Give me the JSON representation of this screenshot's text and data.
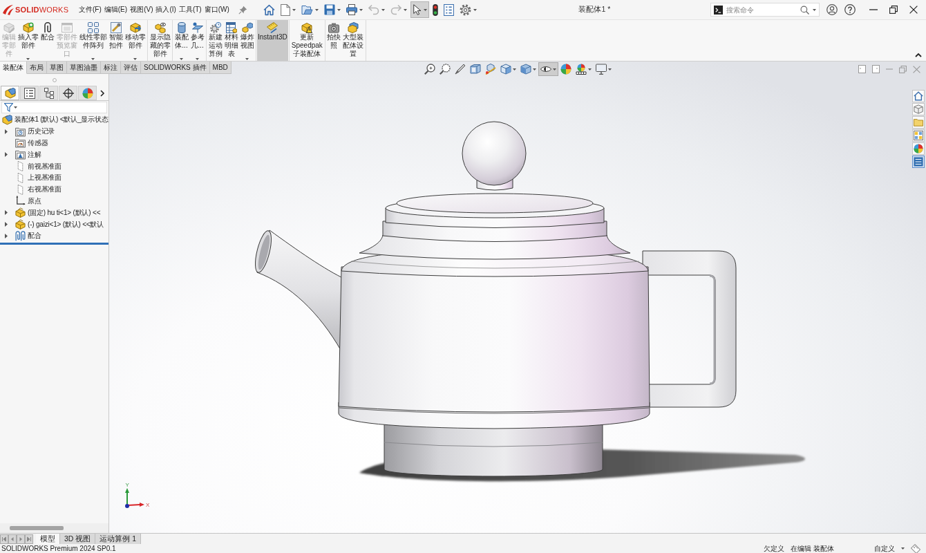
{
  "title_bar": {
    "logo": "**SOLID**WORKS",
    "menus": [
      "文件(F)",
      "编辑(E)",
      "视图(V)",
      "插入(I)",
      "工具(T)",
      "窗口(W)"
    ],
    "quick_access": [
      {
        "dropdown": false,
        "disabled": false,
        "selected": false
      },
      {
        "dropdown": true,
        "disabled": false,
        "selected": false
      },
      {
        "dropdown": true,
        "disabled": false,
        "selected": false
      },
      {
        "dropdown": true,
        "disabled": false,
        "selected": false
      },
      {
        "dropdown": true,
        "disabled": false,
        "selected": false
      },
      {
        "dropdown": true,
        "disabled": true,
        "selected": false
      },
      {
        "dropdown": true,
        "disabled": true,
        "selected": false
      },
      {
        "dropdown": true,
        "disabled": false,
        "selected": true
      },
      {
        "dropdown": false,
        "disabled": false,
        "selected": false
      },
      {
        "dropdown": false,
        "disabled": false,
        "selected": false
      },
      {
        "dropdown": true,
        "disabled": false,
        "selected": false
      }
    ],
    "title": "装配体1 *",
    "search": {
      "placeholder": "搜索命令"
    }
  },
  "ribbon": {
    "groups": [
      {
        "buttons": [
          {
            "label": "编辑零部件",
            "disabled": true,
            "selected": false,
            "dropdown": false
          },
          {
            "label": "插入零部件",
            "disabled": false,
            "selected": false,
            "dropdown": true
          },
          {
            "label": "配合",
            "disabled": false,
            "selected": false,
            "dropdown": false
          },
          {
            "label": "零部件预览窗口",
            "disabled": true,
            "selected": false,
            "dropdown": false
          },
          {
            "label": "线性零部件阵列",
            "disabled": false,
            "selected": false,
            "dropdown": true
          },
          {
            "label": "智能扣件",
            "disabled": false,
            "selected": false,
            "dropdown": false
          },
          {
            "label": "移动零部件",
            "disabled": false,
            "selected": false,
            "dropdown": true
          }
        ]
      },
      {
        "buttons": [
          {
            "label": "显示隐藏的零部件",
            "disabled": false,
            "selected": false,
            "dropdown": false
          }
        ]
      },
      {
        "buttons": [
          {
            "label": "装配体...",
            "disabled": false,
            "selected": false,
            "dropdown": true
          },
          {
            "label": "参考几...",
            "disabled": false,
            "selected": false,
            "dropdown": true
          }
        ]
      },
      {
        "buttons": [
          {
            "label": "新建运动算例",
            "disabled": false,
            "selected": false,
            "dropdown": false
          },
          {
            "label": "材料明细表",
            "disabled": false,
            "selected": false,
            "dropdown": false
          },
          {
            "label": "爆炸视图",
            "disabled": false,
            "selected": false,
            "dropdown": true
          }
        ]
      },
      {
        "buttons": [
          {
            "label": "Instant3D",
            "disabled": false,
            "selected": true,
            "dropdown": false
          }
        ]
      },
      {
        "buttons": [
          {
            "label": "更新Speedpak子装配体",
            "disabled": false,
            "selected": false,
            "dropdown": false
          }
        ]
      },
      {
        "buttons": [
          {
            "label": "拍快照",
            "disabled": false,
            "selected": false,
            "dropdown": false
          },
          {
            "label": "大型装配体设置",
            "disabled": false,
            "selected": false,
            "dropdown": false
          }
        ]
      }
    ]
  },
  "command_tabs": [
    {
      "label": "装配体",
      "selected": true
    },
    {
      "label": "布局",
      "selected": false
    },
    {
      "label": "草图",
      "selected": false
    },
    {
      "label": "草图油墨",
      "selected": false
    },
    {
      "label": "标注",
      "selected": false
    },
    {
      "label": "评估",
      "selected": false
    },
    {
      "label": "SOLIDWORKS 插件",
      "selected": false
    },
    {
      "label": "MBD",
      "selected": false
    }
  ],
  "feature_manager": {
    "tabs": [
      {
        "selected": true
      },
      {
        "selected": false
      },
      {
        "selected": false
      },
      {
        "selected": false
      },
      {
        "selected": false
      }
    ],
    "tree": {
      "kind": "assembly",
      "label": "装配体1 (默认) <默认_显示状态",
      "children": [
        {
          "kind": "history",
          "label": "历史记录",
          "expanded": false
        },
        {
          "kind": "sensors",
          "label": "传感器"
        },
        {
          "kind": "annotations",
          "label": "注解",
          "expanded": false
        },
        {
          "kind": "plane",
          "label": "前视基准面"
        },
        {
          "kind": "plane",
          "label": "上视基准面"
        },
        {
          "kind": "plane",
          "label": "右视基准面"
        },
        {
          "kind": "origin",
          "label": "原点"
        },
        {
          "kind": "part",
          "label": "(固定) hu ti<1> (默认) <<",
          "expanded": false
        },
        {
          "kind": "part",
          "label": "(-) gaizi<1> (默认) <<默认",
          "expanded": false
        },
        {
          "kind": "mates",
          "label": "配合",
          "expanded": false
        }
      ]
    }
  },
  "viewport": {
    "heads_up": [
      {
        "dropdown": false,
        "selected": false
      },
      {
        "dropdown": false,
        "selected": false
      },
      {
        "dropdown": false,
        "selected": false
      },
      {
        "dropdown": false,
        "selected": false
      },
      {
        "dropdown": false,
        "selected": false
      },
      {
        "dropdown": true,
        "selected": false
      },
      {
        "dropdown": true,
        "selected": false
      },
      {
        "dropdown": true,
        "selected": true
      },
      {
        "dropdown": false,
        "selected": false
      },
      {
        "dropdown": true,
        "selected": false
      },
      {
        "dropdown": true,
        "selected": false
      }
    ],
    "triad": {
      "y_label": "Y",
      "x_label": "X"
    }
  },
  "bottom_tabs": [
    {
      "label": "模型",
      "selected": true
    },
    {
      "label": "3D 视图",
      "selected": false
    },
    {
      "label": "运动算例 1",
      "selected": false
    }
  ],
  "status_bar": {
    "product": "SOLIDWORKS Premium 2024 SP0.1",
    "definition": "欠定义",
    "mode": "在编辑 装配体",
    "units": "自定义"
  }
}
